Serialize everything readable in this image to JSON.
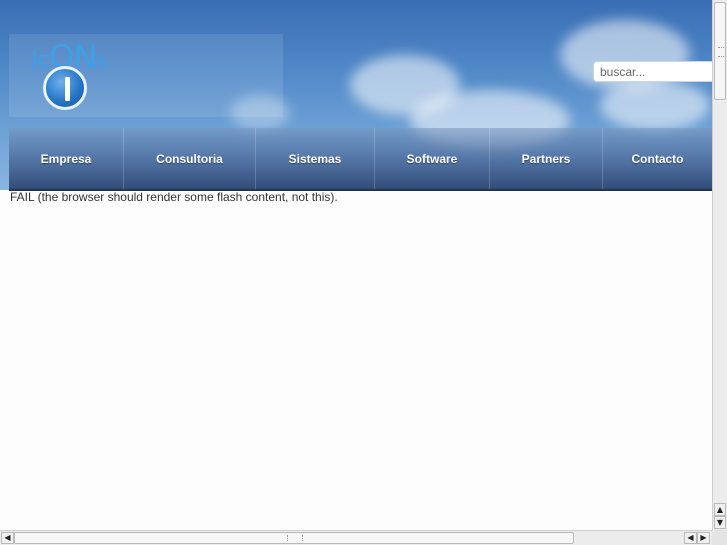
{
  "logo": {
    "letters": [
      "Ic",
      "ON",
      "s"
    ]
  },
  "search": {
    "placeholder": "buscar..."
  },
  "nav": {
    "items": [
      "Empresa",
      "Consultoria",
      "Sistemas",
      "Software",
      "Partners",
      "Contacto"
    ]
  },
  "content": {
    "fail_message": "FAIL (the browser should render some flash content, not this)."
  },
  "colors": {
    "nav_text": "#ffffff",
    "logo_blue": "#3aa0e8",
    "sky_top": "#3a6eb4"
  },
  "icons": {
    "scroll_up": "triangle-up",
    "scroll_down": "triangle-down",
    "scroll_left": "triangle-left",
    "scroll_right": "triangle-right"
  }
}
